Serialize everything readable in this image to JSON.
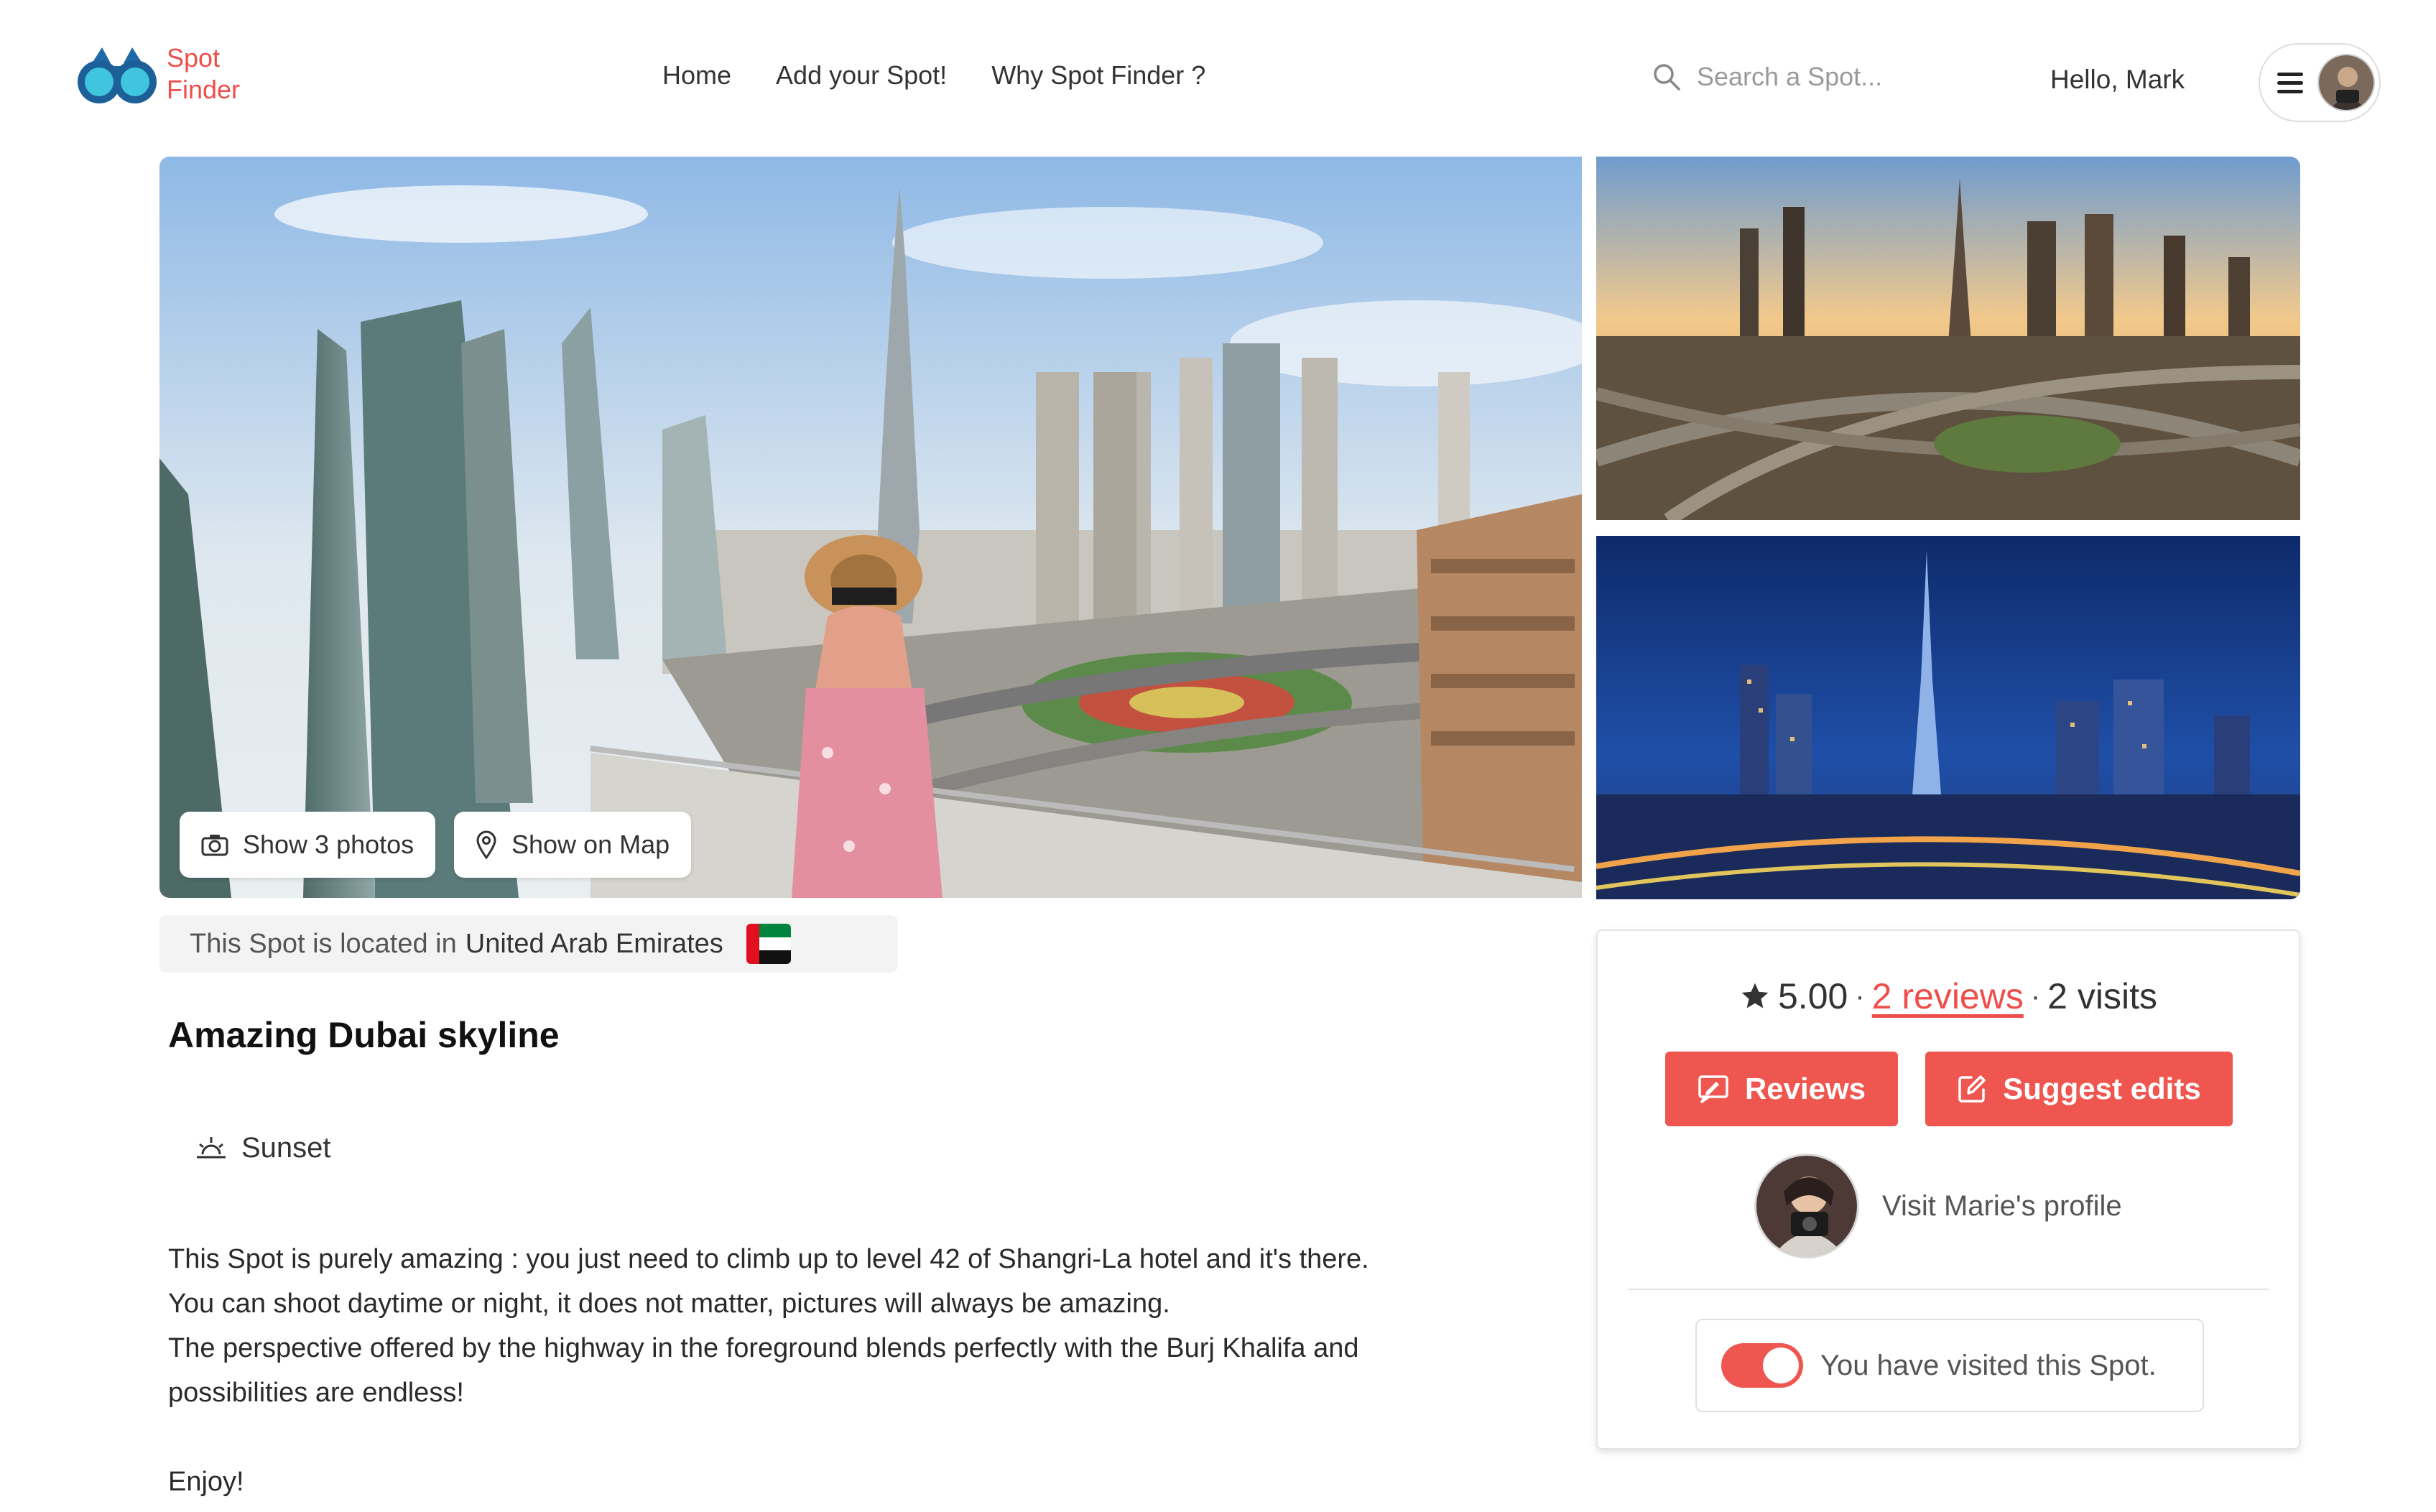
{
  "brand": {
    "line1": "Spot",
    "line2": "Finder",
    "accent": "#ee4f4a"
  },
  "nav": {
    "items": [
      "Home",
      "Add your Spot!",
      "Why Spot Finder ?"
    ]
  },
  "search": {
    "placeholder": "Search a Spot..."
  },
  "user": {
    "greeting": "Hello, Mark",
    "menu_icon": "hamburger-icon"
  },
  "gallery": {
    "show_photos_label": "Show 3 photos",
    "show_map_label": "Show on Map"
  },
  "location": {
    "prefix": "This Spot is located in",
    "country": "United Arab Emirates",
    "flag": "uae-flag"
  },
  "spot": {
    "title": "Amazing Dubai skyline",
    "tag": "Sunset",
    "description": [
      "This Spot is purely amazing : you just need to climb up to level 42 of Shangri-La hotel and it's there.",
      "You can shoot daytime or night, it does not matter, pictures will always be amazing.",
      "The perspective offered by the highway in the foreground blends perfectly with the Burj Khalifa and",
      "possibilities are endless!"
    ],
    "sign_off": "Enjoy!"
  },
  "card": {
    "rating": "5.00",
    "reviews_link": "2 reviews",
    "visits": "2 visits",
    "reviews_button": "Reviews",
    "suggest_button": "Suggest edits",
    "profile_link": "Visit Marie's profile",
    "visited_label": "You have visited this Spot.",
    "visited": true
  }
}
